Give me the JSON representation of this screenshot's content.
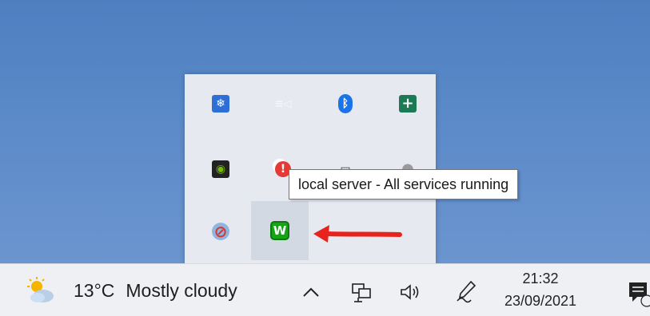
{
  "tray_panel": {
    "tooltip_text": "local server - All services running",
    "icons": [
      {
        "name": "snowflake-app-icon",
        "glyph": "❄",
        "bg": "#2d6fd6",
        "fg": "#ffffff"
      },
      {
        "name": "media-cast-icon",
        "glyph": "≡◁",
        "bg": "transparent",
        "fg": "#f4f7fb"
      },
      {
        "name": "bluetooth-icon",
        "glyph": "ᛒ",
        "bg": "#1a73e8",
        "fg": "#ffffff"
      },
      {
        "name": "green-plus-icon",
        "glyph": "+",
        "bg": "#1d7a55",
        "fg": "#ffffff"
      },
      {
        "name": "nvidia-icon",
        "glyph": "◉",
        "bg": "#222222",
        "fg": "#76b900"
      },
      {
        "name": "security-alert-icon",
        "glyph": "!",
        "bg": "#e53935",
        "fg": "#ffffff"
      },
      {
        "name": "battery-device-icon",
        "glyph": "▭",
        "bg": "transparent",
        "fg": "#333333"
      },
      {
        "name": "grey-circle-icon",
        "glyph": "●",
        "bg": "transparent",
        "fg": "#9a9a9a"
      },
      {
        "name": "blocked-app-icon",
        "glyph": "⊘",
        "bg": "transparent",
        "fg": "#d9342b"
      },
      {
        "name": "wamp-server-icon",
        "glyph": "W",
        "bg": "#17a317",
        "fg": "#ffffff"
      }
    ]
  },
  "taskbar": {
    "weather": {
      "temperature": "13°C",
      "condition": "Mostly cloudy"
    },
    "clock": {
      "time": "21:32",
      "date": "23/09/2021"
    }
  },
  "colors": {
    "arrow": "#e8231e",
    "taskbar_bg": "#eef0f3",
    "panel_bg": "#e6eaf0"
  }
}
